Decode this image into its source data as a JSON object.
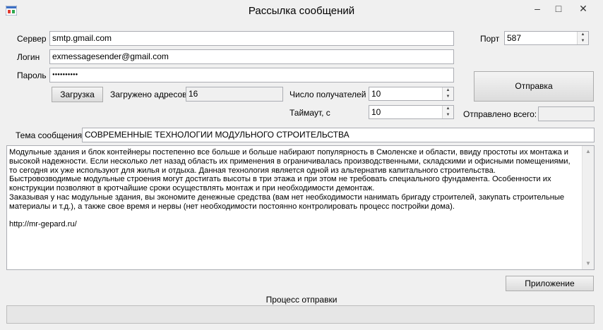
{
  "window": {
    "title": "Рассылка сообщений",
    "minimize": "–",
    "maximize": "□",
    "close": "✕"
  },
  "server": {
    "label": "Сервер",
    "value": "smtp.gmail.com"
  },
  "login": {
    "label": "Логин",
    "value": "exmessagesender@gmail.com"
  },
  "password": {
    "label": "Пароль",
    "value": "●●●●●●●●●●"
  },
  "port": {
    "label": "Порт",
    "value": "587"
  },
  "load_button": "Загрузка",
  "loaded": {
    "label": "Загружено адресов:",
    "value": "16"
  },
  "recipients": {
    "label": "Число получателей",
    "value": "10"
  },
  "timeout": {
    "label": "Таймаут, с",
    "value": "10"
  },
  "send_button": "Отправка",
  "sent_total": {
    "label": "Отправлено всего:",
    "value": ""
  },
  "subject": {
    "label": "Тема сообщения",
    "value": "СОВРЕМЕННЫЕ ТЕХНОЛОГИИ МОДУЛЬНОГО СТРОИТЕЛЬСТВА"
  },
  "message": "Модульные здания и блок контейнеры постепенно все больше и больше набирают популярность в Смоленске и области, ввиду простоты их монтажа и высокой надежности. Если несколько лет назад область их применения в ограничивалась производственными, складскими и офисными помещениями, то сегодня их уже используют для жилья и отдыха. Данная технология является одной из альтернатив капитального строительства.\nБыстровозводимые модульные строения могут достигать высоты в три этажа и при этом не требовать специального фундамента. Особенности их конструкции позволяют в кротчайшие сроки осуществлять монтаж и при необходимости демонтаж.\nЗаказывая у нас модульные здания, вы экономите денежные средства (вам нет необходимости нанимать бригаду строителей, закупать строительные материалы и т.д.), а также свое время и нервы (нет необходимости постоянно контролировать процесс постройки дома).\n\nhttp://mr-gepard.ru/",
  "attachment_button": "Приложение",
  "progress": {
    "label": "Процесс отправки",
    "value": 0
  }
}
